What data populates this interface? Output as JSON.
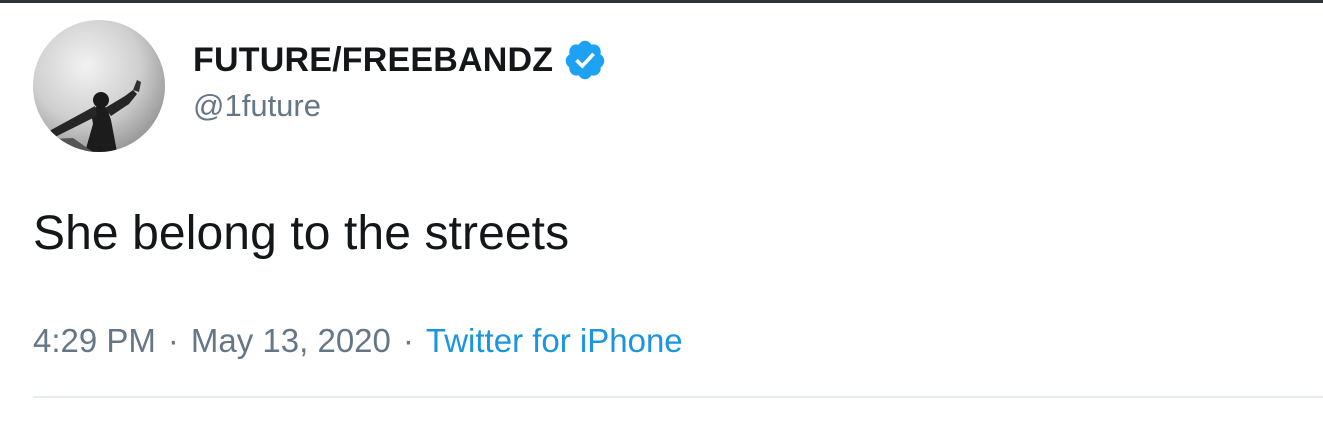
{
  "tweet": {
    "author": {
      "display_name": "FUTURE/FREEBANDZ",
      "handle": "@1future",
      "verified": true,
      "avatar_icon": "profile-photo"
    },
    "text": "She belong to the streets",
    "time": "4:29 PM",
    "separator": "·",
    "date": "May 13, 2020",
    "source": "Twitter for iPhone"
  },
  "colors": {
    "text_primary": "#14171a",
    "text_secondary": "#657786",
    "link": "#1b95e0",
    "verified_badge": "#1da1f2",
    "divider": "#e6ecf0"
  }
}
